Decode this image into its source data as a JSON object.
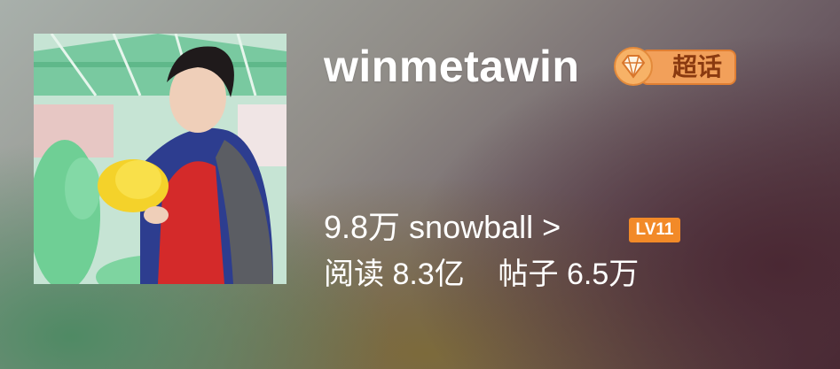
{
  "topic": {
    "name": "winmetawin",
    "badge_label": "超话",
    "followers_text": "9.8万 snowball >",
    "level": "LV11",
    "reads_text": "阅读 8.3亿",
    "posts_text": "帖子 6.5万"
  },
  "icons": {
    "badge": "diamond-icon"
  },
  "colors": {
    "badge_fill": "#f2a05a",
    "level_fill": "#f28a28",
    "text": "#ffffff"
  }
}
